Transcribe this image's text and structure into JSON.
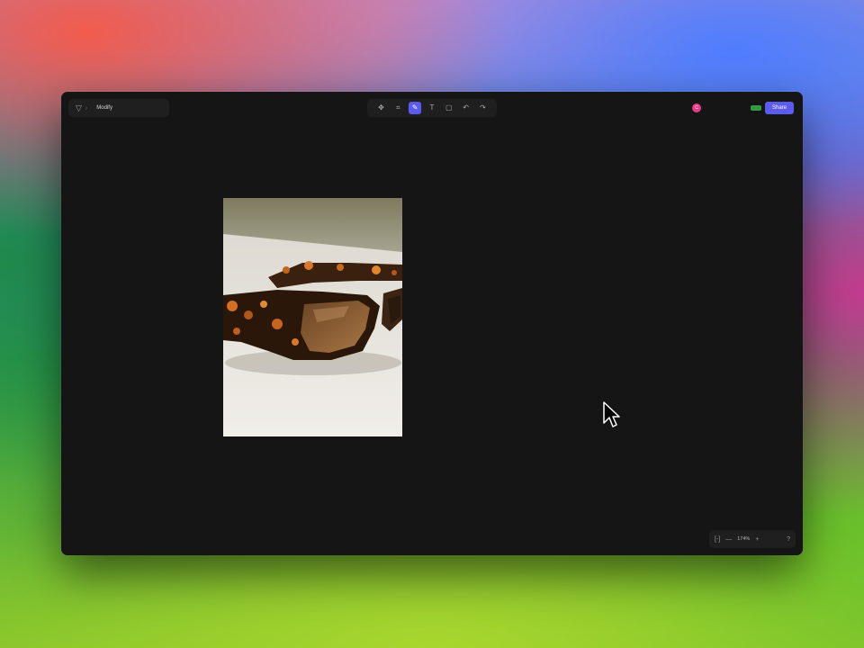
{
  "project": {
    "name": "Modify",
    "logo_icon": "app-logo-icon",
    "menu_icon": "chevron-down-icon"
  },
  "toolbar": {
    "tools": [
      {
        "name": "move-tool",
        "icon": "✥",
        "active": false
      },
      {
        "name": "frame-tool",
        "icon": "⌗",
        "active": false
      },
      {
        "name": "pen-tool",
        "icon": "✎",
        "active": true
      },
      {
        "name": "text-tool",
        "icon": "T",
        "active": false
      },
      {
        "name": "rectangle-tool",
        "icon": "▢",
        "active": false
      },
      {
        "name": "undo-tool",
        "icon": "↶",
        "active": false
      },
      {
        "name": "redo-tool",
        "icon": "↷",
        "active": false
      }
    ]
  },
  "header_right": {
    "avatar_initial": "C",
    "share_label": "Share"
  },
  "zoom": {
    "fit_icon": "[-]",
    "minus": "—",
    "value": "174%",
    "plus": "+",
    "help": "?"
  },
  "colors": {
    "accent": "#5b5bf0",
    "avatar": "#ea3a8a",
    "status": "#2f9b45",
    "window_bg": "#151515"
  }
}
